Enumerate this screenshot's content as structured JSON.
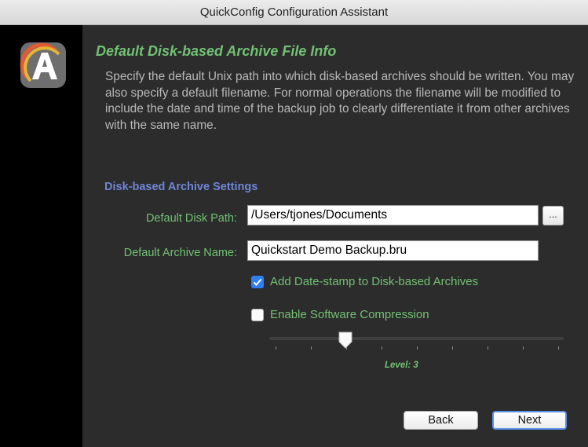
{
  "window": {
    "title": "QuickConfig Configuration Assistant"
  },
  "page": {
    "heading": "Default Disk-based Archive File Info",
    "description": "Specify the default Unix path into which disk-based archives should be written.  You may also specify a default filename.  For normal operations the filename will be modified to include the date and time of the backup job to clearly differentiate it from other archives with the same name."
  },
  "settings": {
    "section_title": "Disk-based Archive Settings",
    "disk_path_label": "Default Disk Path:",
    "disk_path_value": "/Users/tjones/Documents",
    "browse_label": "...",
    "archive_name_label": "Default Archive Name:",
    "archive_name_value": "Quickstart Demo Backup.bru",
    "datestamp": {
      "label": "Add Date-stamp to Disk-based Archives",
      "checked": true
    },
    "compression": {
      "label": "Enable Software Compression",
      "checked": false
    },
    "level": {
      "label": "Level: 3",
      "value": 3,
      "min": 1,
      "max": 9
    }
  },
  "buttons": {
    "back": "Back",
    "next": "Next"
  },
  "colors": {
    "accent_green": "#72c173",
    "section_blue": "#6f86d7",
    "checkbox_blue": "#2f7ef5"
  }
}
